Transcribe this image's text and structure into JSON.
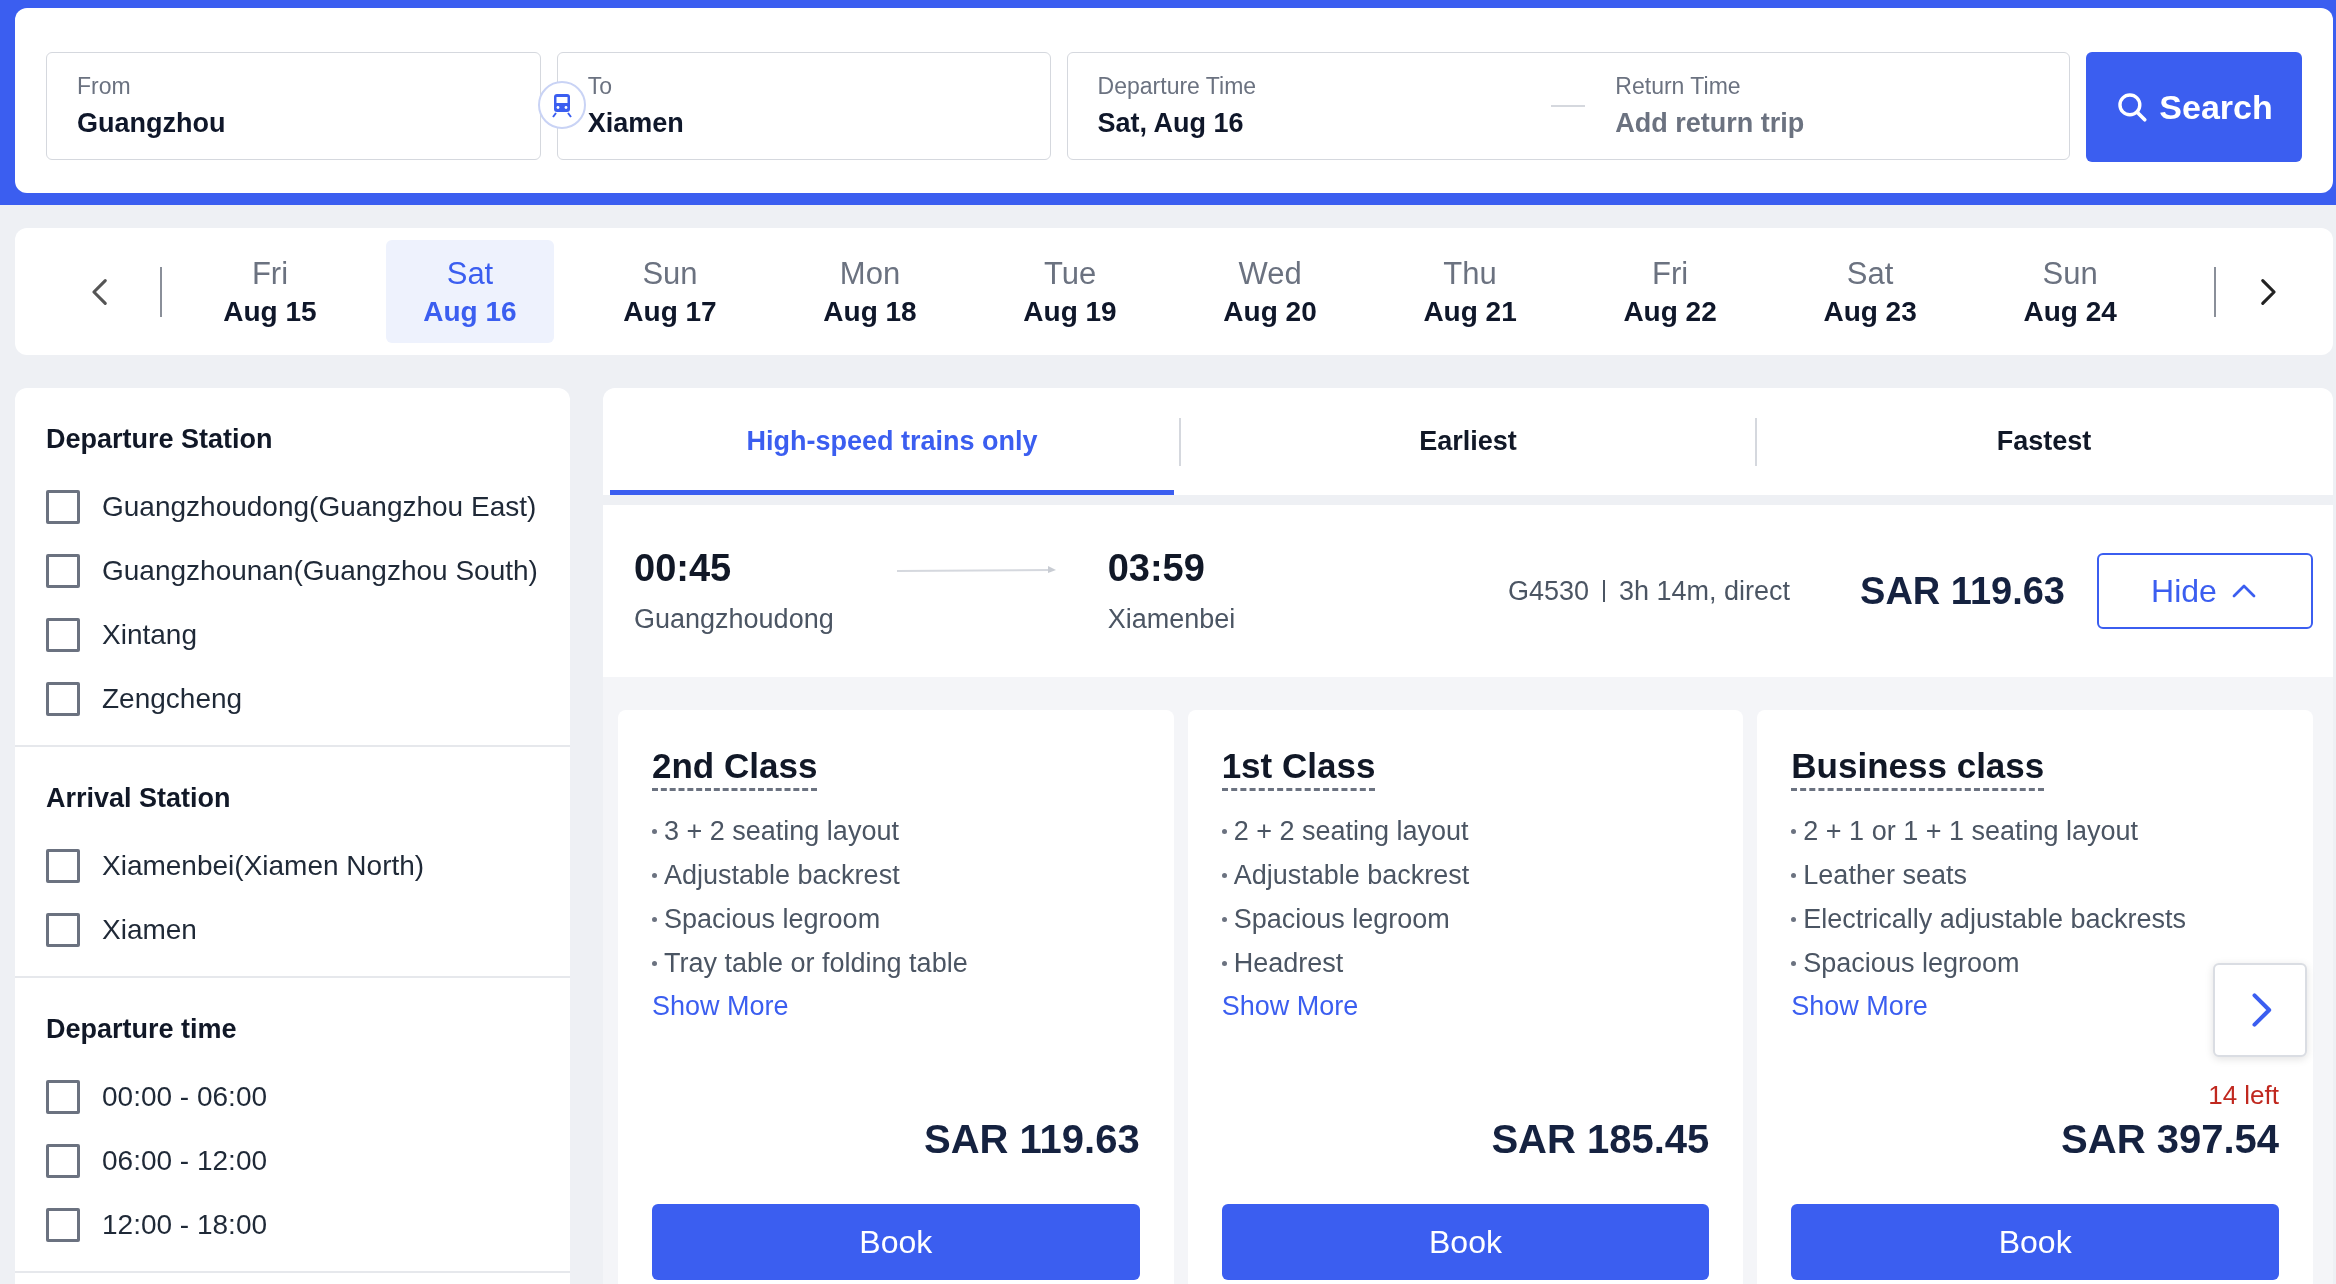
{
  "search": {
    "from": {
      "label": "From",
      "value": "Guangzhou"
    },
    "to": {
      "label": "To",
      "value": "Xiamen"
    },
    "departure": {
      "label": "Departure Time",
      "value": "Sat, Aug 16"
    },
    "return": {
      "label": "Return Time",
      "placeholder": "Add return trip"
    },
    "button": "Search"
  },
  "dates": [
    {
      "weekday": "Fri",
      "date": "Aug 15",
      "selected": false
    },
    {
      "weekday": "Sat",
      "date": "Aug 16",
      "selected": true
    },
    {
      "weekday": "Sun",
      "date": "Aug 17",
      "selected": false
    },
    {
      "weekday": "Mon",
      "date": "Aug 18",
      "selected": false
    },
    {
      "weekday": "Tue",
      "date": "Aug 19",
      "selected": false
    },
    {
      "weekday": "Wed",
      "date": "Aug 20",
      "selected": false
    },
    {
      "weekday": "Thu",
      "date": "Aug 21",
      "selected": false
    },
    {
      "weekday": "Fri",
      "date": "Aug 22",
      "selected": false
    },
    {
      "weekday": "Sat",
      "date": "Aug 23",
      "selected": false
    },
    {
      "weekday": "Sun",
      "date": "Aug 24",
      "selected": false
    }
  ],
  "filters": [
    {
      "title": "Departure Station",
      "options": [
        {
          "label": "Guangzhoudong(Guangzhou East)",
          "checked": false
        },
        {
          "label": "Guangzhounan(Guangzhou South)",
          "checked": false
        },
        {
          "label": "Xintang",
          "checked": false
        },
        {
          "label": "Zengcheng",
          "checked": false
        }
      ]
    },
    {
      "title": "Arrival Station",
      "options": [
        {
          "label": "Xiamenbei(Xiamen North)",
          "checked": false
        },
        {
          "label": "Xiamen",
          "checked": false
        }
      ]
    },
    {
      "title": "Departure time",
      "options": [
        {
          "label": "00:00 - 06:00",
          "checked": false
        },
        {
          "label": "06:00 - 12:00",
          "checked": false
        },
        {
          "label": "12:00 - 18:00",
          "checked": false
        }
      ]
    }
  ],
  "sort_tabs": [
    {
      "label": "High-speed trains only",
      "selected": true
    },
    {
      "label": "Earliest",
      "selected": false
    },
    {
      "label": "Fastest",
      "selected": false
    }
  ],
  "train": {
    "departure_time": "00:45",
    "departure_station": "Guangzhoudong",
    "arrival_time": "03:59",
    "arrival_station": "Xiamenbei",
    "number": "G4530",
    "duration": "3h 14m, direct",
    "price": "SAR 119.63",
    "toggle": "Hide",
    "expanded": true
  },
  "classes": [
    {
      "name": "2nd Class",
      "features": [
        "3 + 2 seating layout",
        "Adjustable backrest",
        "Spacious legroom",
        "Tray table or folding table"
      ],
      "more": "Show More",
      "price": "SAR 119.63",
      "button": "Book"
    },
    {
      "name": "1st Class",
      "features": [
        "2 + 2 seating layout",
        "Adjustable backrest",
        "Spacious legroom",
        "Headrest"
      ],
      "more": "Show More",
      "price": "SAR 185.45",
      "button": "Book"
    },
    {
      "name": "Business class",
      "features": [
        "2 + 1 or 1 + 1 seating layout",
        "Leather seats",
        "Electrically adjustable backrests",
        "Spacious legroom"
      ],
      "more": "Show More",
      "availability": "14 left",
      "price": "SAR 397.54",
      "button": "Book"
    }
  ]
}
